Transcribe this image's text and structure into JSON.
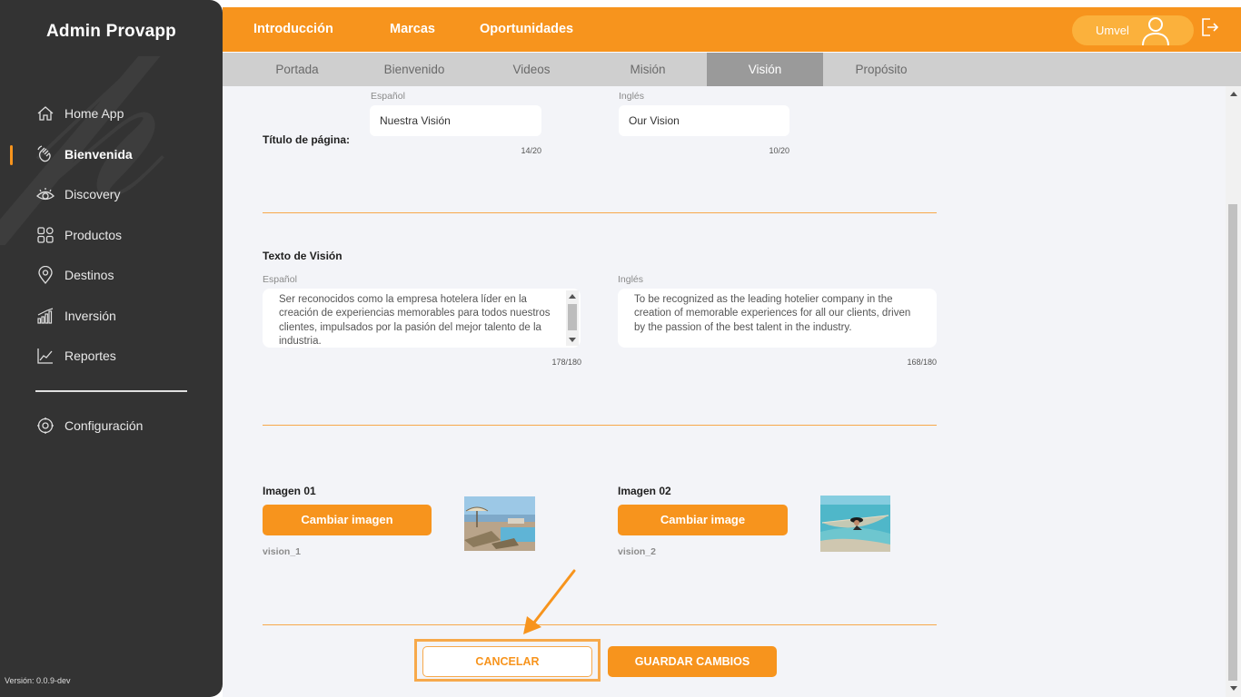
{
  "sidebar": {
    "title": "Admin Provapp",
    "items": [
      {
        "label": "Home App",
        "icon": "home-icon"
      },
      {
        "label": "Bienvenida",
        "icon": "wave-hand-icon"
      },
      {
        "label": "Discovery",
        "icon": "eye-icon"
      },
      {
        "label": "Productos",
        "icon": "grid-icon"
      },
      {
        "label": "Destinos",
        "icon": "location-pin-icon"
      },
      {
        "label": "Inversión",
        "icon": "bar-chart-icon"
      },
      {
        "label": "Reportes",
        "icon": "line-chart-icon"
      }
    ],
    "config_label": "Configuración",
    "version": "Versión: 0.0.9-dev"
  },
  "topbar": {
    "tabs": [
      "Introducción",
      "Marcas",
      "Oportunidades"
    ],
    "user_name": "Umvel"
  },
  "subtabs": [
    "Portada",
    "Bienvenido",
    "Videos",
    "Misión",
    "Visión",
    "Propósito"
  ],
  "form": {
    "page_title_label": "Título de página:",
    "spanish_label": "Español",
    "english_label": "Inglés",
    "title_es": "Nuestra Visión",
    "title_en": "Our Vision",
    "title_es_count": "14/20",
    "title_en_count": "10/20",
    "vision_text_label": "Texto de Visión",
    "vision_es": "Ser reconocidos como la empresa hotelera líder en la creación de experiencias memorables para todos nuestros clientes, impulsados por la pasión del mejor talento de la industria.",
    "vision_en": "To be recognized as the leading hotelier company in the creation of memorable experiences for all our clients, driven by the passion of the best talent in the industry.",
    "vision_es_count": "178/180",
    "vision_en_count": "168/180",
    "image1_label": "Imagen 01",
    "image1_button": "Cambiar imagen",
    "image1_name": "vision_1",
    "image2_label": "Imagen 02",
    "image2_button": "Cambiar image",
    "image2_name": "vision_2",
    "cancel": "CANCELAR",
    "save": "GUARDAR CAMBIOS"
  },
  "colors": {
    "accent": "#F7941D",
    "sidebar_bg": "#333333",
    "content_bg": "#f3f4f8"
  }
}
